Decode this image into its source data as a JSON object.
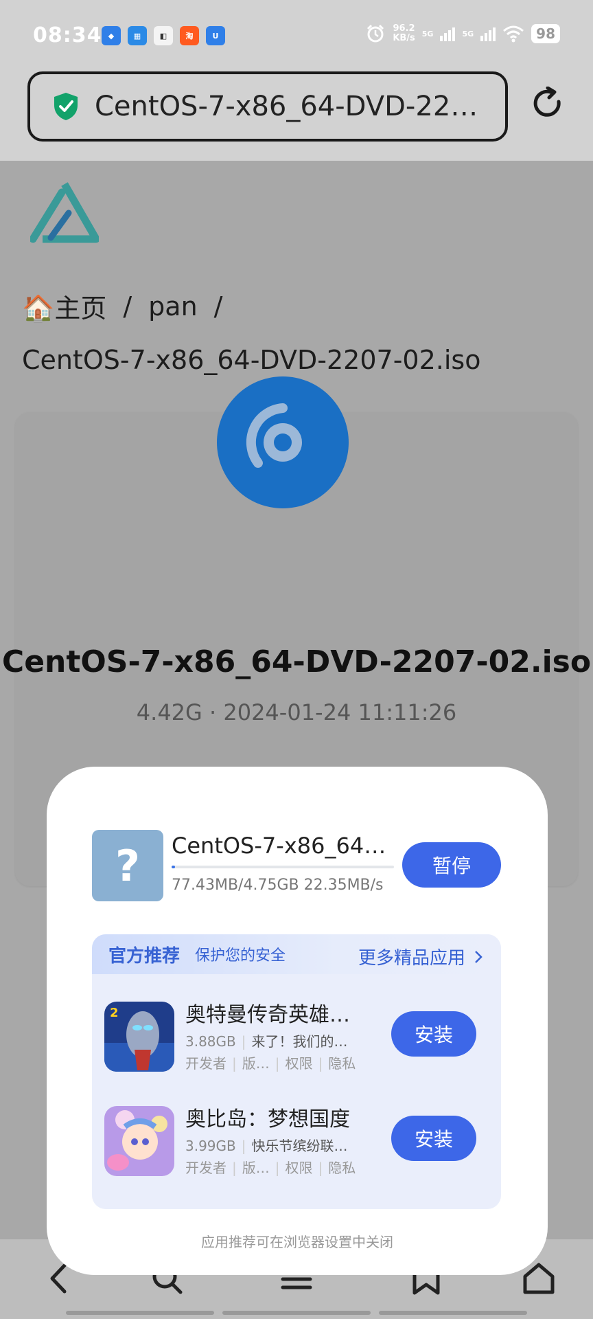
{
  "status_bar": {
    "time": "08:34",
    "speed_value": "96.2",
    "speed_unit": "KB/s",
    "network1": "5G",
    "network2": "5G",
    "battery": "98",
    "app_icons": [
      "xiaohongshu-icon",
      "game-live-icon",
      "app-icon",
      "taobao-icon",
      "shield-app-icon"
    ]
  },
  "url_bar": {
    "title": "CentOS-7-x86_64-DVD-22…"
  },
  "page": {
    "breadcrumb_home": "主页",
    "breadcrumb_sep": "/",
    "breadcrumb_folder": "pan",
    "breadcrumb_file": "CentOS-7-x86_64-DVD-2207-02.iso",
    "file_name": "CentOS-7-x86_64-DVD-2207-02.iso",
    "file_meta": "4.42G · 2024-01-24 11:11:26"
  },
  "download": {
    "file_name": "CentOS-7-x86_64…",
    "stats": "77.43MB/4.75GB  22.35MB/s",
    "progress": 0.016,
    "pause_label": "暂停"
  },
  "recommend": {
    "title": "官方推荐",
    "subtitle": "保护您的安全",
    "more": "更多精品应用",
    "apps": [
      {
        "name": "奥特曼传奇英雄…",
        "size": "3.88GB",
        "desc": "来了！我们的…",
        "links": [
          "开发者",
          "版…",
          "权限",
          "隐私"
        ],
        "install": "安装"
      },
      {
        "name": "奥比岛：梦想国度",
        "size": "3.99GB",
        "desc": "快乐节缤纷联…",
        "links": [
          "开发者",
          "版…",
          "权限",
          "隐私"
        ],
        "install": "安装"
      }
    ]
  },
  "footer_note": "应用推荐可在浏览器设置中关闭",
  "colors": {
    "accent": "#3d67e8",
    "disc": "#1a6fc4",
    "logo": "#3a9a98"
  }
}
